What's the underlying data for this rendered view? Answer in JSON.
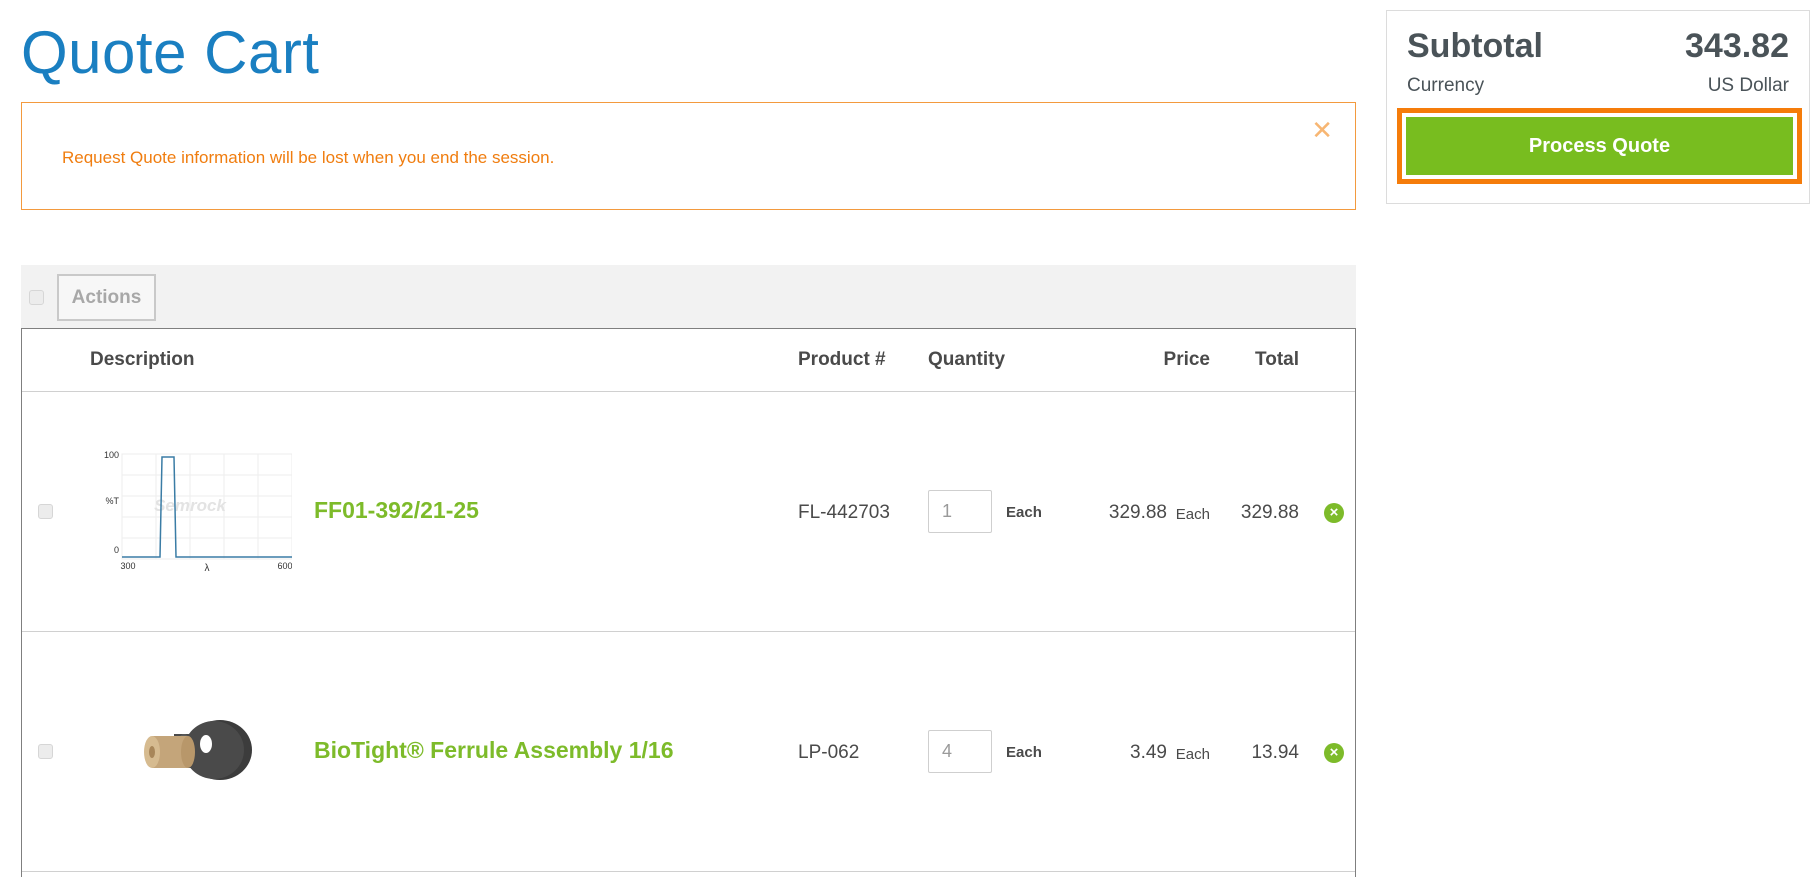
{
  "page": {
    "title": "Quote Cart"
  },
  "notice": {
    "text": "Request Quote information will be lost when you end the session.",
    "close_glyph": "✕"
  },
  "toolbar": {
    "actions_label": "Actions"
  },
  "table": {
    "headers": {
      "description": "Description",
      "product": "Product #",
      "quantity": "Quantity",
      "price": "Price",
      "total": "Total"
    },
    "items": [
      {
        "name": "FF01-392/21-25",
        "product_number": "FL-442703",
        "quantity": "1",
        "quantity_unit": "Each",
        "price": "329.88",
        "price_unit": "Each",
        "total": "329.88",
        "thumb": {
          "label_100": "100",
          "label_t": "%T",
          "label_0": "0",
          "label_300": "300",
          "label_lambda": "λ",
          "label_600": "600",
          "watermark": "Semrock"
        }
      },
      {
        "name": "BioTight® Ferrule Assembly 1/16",
        "product_number": "LP-062",
        "quantity": "4",
        "quantity_unit": "Each",
        "price": "3.49",
        "price_unit": "Each",
        "total": "13.94"
      }
    ]
  },
  "summary": {
    "subtotal_label": "Subtotal",
    "subtotal_value": "343.82",
    "currency_label": "Currency",
    "currency_value": "US Dollar",
    "process_label": "Process Quote"
  },
  "icons": {
    "remove": "remove-circle-icon",
    "close": "close-icon"
  },
  "colors": {
    "title_blue": "#1a7fc1",
    "notice_orange": "#f07d0f",
    "link_green": "#7dbb2a",
    "button_green": "#78bd1f",
    "highlight_orange": "#f57c0a"
  }
}
